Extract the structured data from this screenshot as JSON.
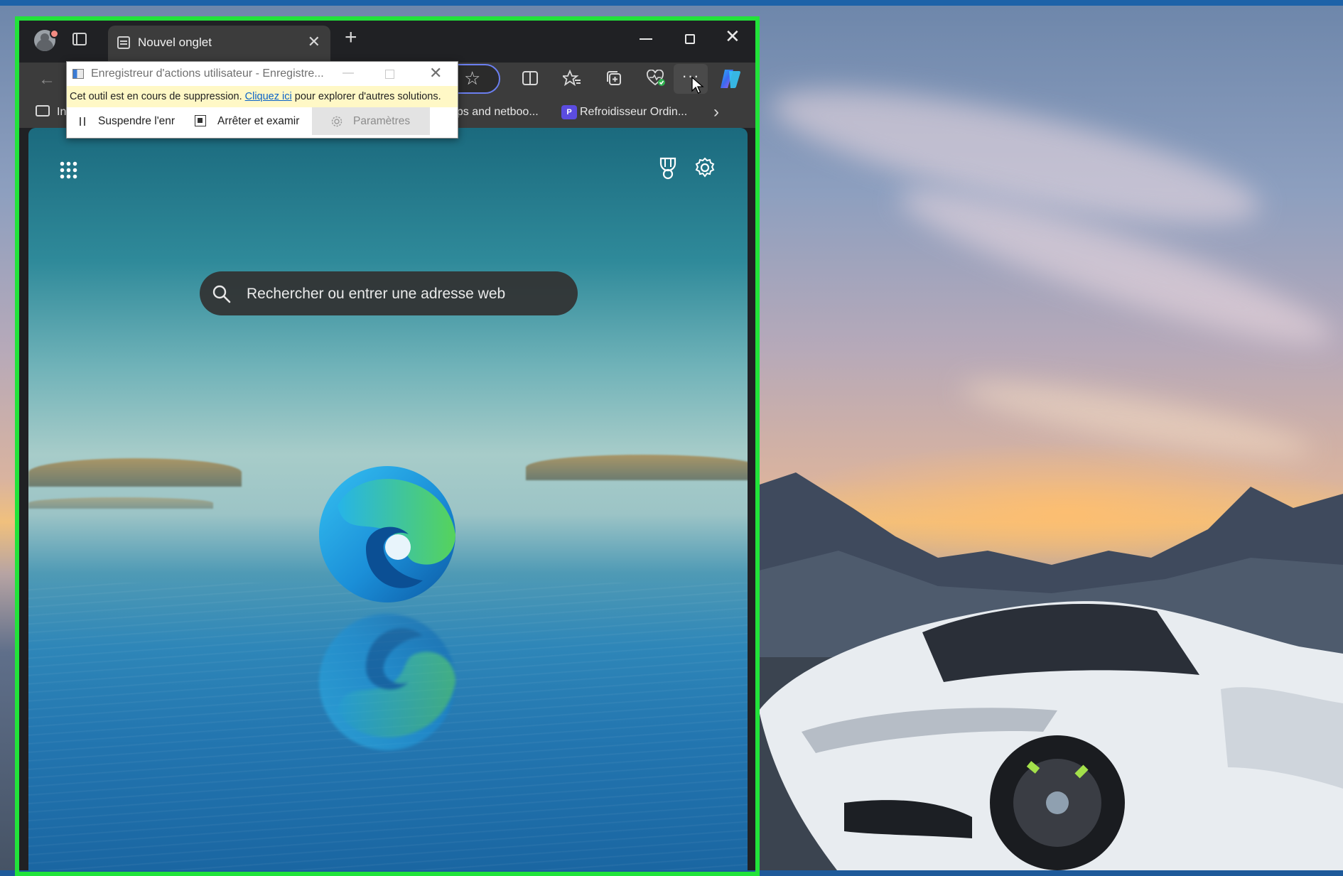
{
  "browser": {
    "tab_title": "Nouvel onglet",
    "tab_close": "✕",
    "new_tab": "+",
    "window_close": "✕",
    "more_label": "···",
    "back_arrow": "←"
  },
  "favorites_bar": {
    "truncated_item": "In",
    "item1": "ops and netboo...",
    "item2": "Refroidisseur Ordin...",
    "item2_icon_text": "P",
    "chevron": "›"
  },
  "new_tab_page": {
    "search_placeholder": "Rechercher ou entrer une adresse web"
  },
  "steps_recorder": {
    "title": "Enregistreur d'actions utilisateur - Enregistre...",
    "min": "—",
    "close": "✕",
    "warning_prefix": "Cet outil est en cours de suppression.",
    "warning_link": "Cliquez ici",
    "warning_suffix": "pour explorer d'autres solutions.",
    "pause_label": "Suspendre l'enr",
    "stop_label": "Arrêter et examir",
    "settings_label": "Paramètres"
  },
  "colors": {
    "frame_highlight": "#22e33a",
    "browser_chrome": "#202124",
    "toolbar": "#3c3c3c",
    "address_focus": "#6b7ff0",
    "warning_bg": "#fff8c6",
    "link": "#0a62c8"
  },
  "icons": {
    "profile": "avatar-icon",
    "sidebar": "sidebar-icon",
    "tab_favicon": "new-tab-favicon-icon",
    "favorite": "star-icon",
    "split_screen": "split-screen-icon",
    "favorites": "favorites-icon",
    "collections": "collections-icon",
    "browser_essentials": "heart-pulse-icon",
    "copilot": "copilot-icon",
    "apps": "apps-grid-icon",
    "rewards": "trophy-icon",
    "settings": "gear-icon",
    "search": "search-icon"
  }
}
